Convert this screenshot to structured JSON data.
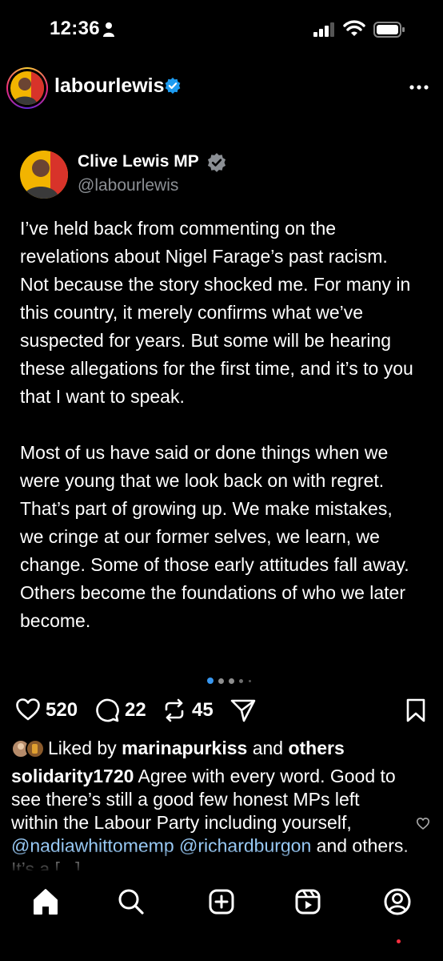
{
  "status_bar": {
    "time": "12:36"
  },
  "header": {
    "username": "labourlewis"
  },
  "tweet": {
    "display_name": "Clive Lewis MP",
    "handle": "@labourlewis",
    "paragraphs": [
      "I’ve held back from commenting on the revelations about Nigel Farage’s past racism. Not because the story shocked me. For many in this country, it merely confirms what we’ve suspected for years. But some will be hearing these allegations for the first time, and it’s to you that I want to speak.",
      "Most of us have said or done things when we were young that we look back on with regret. That’s part of growing up. We make mistakes, we cringe at our former selves, we learn, we change. Some of those early attitudes fall away. Others become the foundations of who we later become."
    ]
  },
  "carousel": {
    "total_dots": 5,
    "active_index": 0
  },
  "actions": {
    "likes": "520",
    "comments": "22",
    "reposts": "45"
  },
  "liked_by": {
    "prefix": "Liked by",
    "user": "marinapurkiss",
    "and": "and",
    "others": "others"
  },
  "caption": {
    "username": "solidarity1720",
    "text": "Agree with every word. Good to see there’s still a good few honest MPs left within the Labour Party including yourself,",
    "mention1": "@nadiawhittomemp",
    "mention2": "@richardburgon",
    "tail": "and others. It’s a [...]"
  },
  "colors": {
    "verified": "#1d9bf0",
    "mention": "#98c9f5",
    "notification": "#ff3040"
  },
  "icons": [
    "person-icon",
    "signal-icon",
    "wifi-icon",
    "battery-icon",
    "verified-icon",
    "more-icon",
    "heart-icon",
    "comment-icon",
    "repost-icon",
    "share-icon",
    "bookmark-icon",
    "home-icon",
    "search-icon",
    "create-icon",
    "reels-icon",
    "profile-icon"
  ]
}
